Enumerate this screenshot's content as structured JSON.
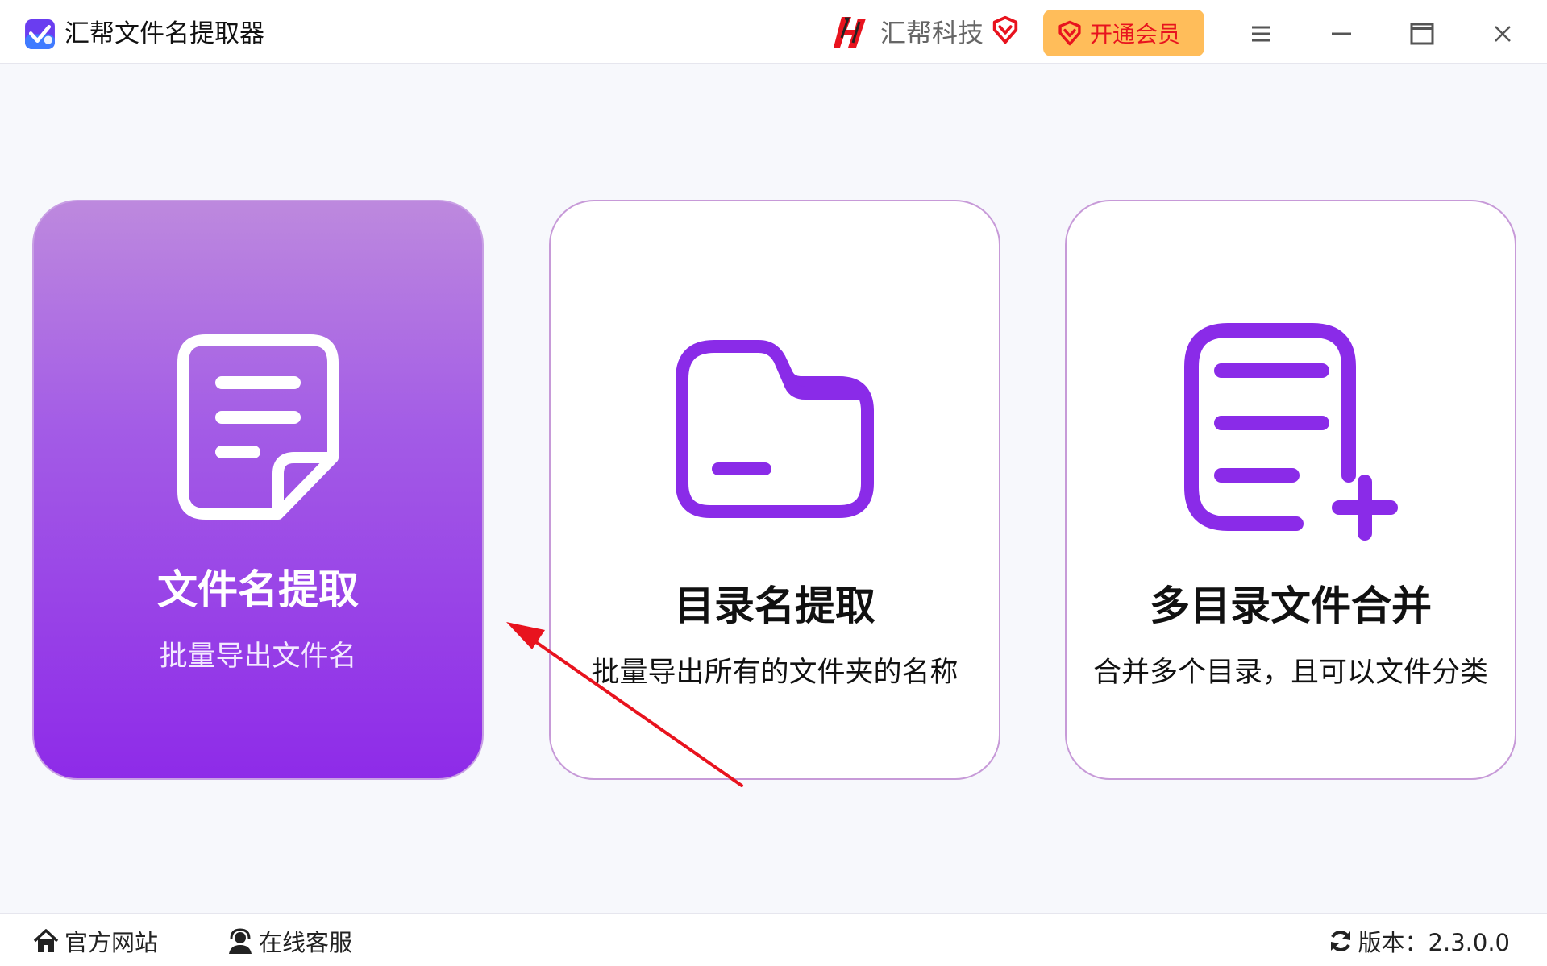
{
  "window": {
    "title": "汇帮文件名提取器",
    "brand_name": "汇帮科技",
    "vip_button_label": "开通会员"
  },
  "icons": {
    "app_logo": "app-logo-icon",
    "brand_logo": "brand-logo-icon",
    "vip": "diamond-icon",
    "menu": "menu-icon",
    "minimize": "minimize-icon",
    "maximize": "maximize-icon",
    "close": "close-icon",
    "home": "home-icon",
    "support": "headset-user-icon",
    "version": "refresh-icon"
  },
  "colors": {
    "accent": "#8a2be8",
    "vip_button_bg": "#ffbd5a",
    "vip_red": "#e8131e",
    "card_border": "#c79ad8"
  },
  "cards": [
    {
      "title": "文件名提取",
      "description": "批量导出文件名",
      "icon": "document-icon",
      "selected": true
    },
    {
      "title": "目录名提取",
      "description": "批量导出所有的文件夹的名称",
      "icon": "folder-icon",
      "selected": false
    },
    {
      "title": "多目录文件合并",
      "description": "合并多个目录，且可以文件分类",
      "icon": "list-add-icon",
      "selected": false
    }
  ],
  "footer": {
    "website_label": "官方网站",
    "support_label": "在线客服",
    "version_label": "版本：2.3.0.0"
  }
}
